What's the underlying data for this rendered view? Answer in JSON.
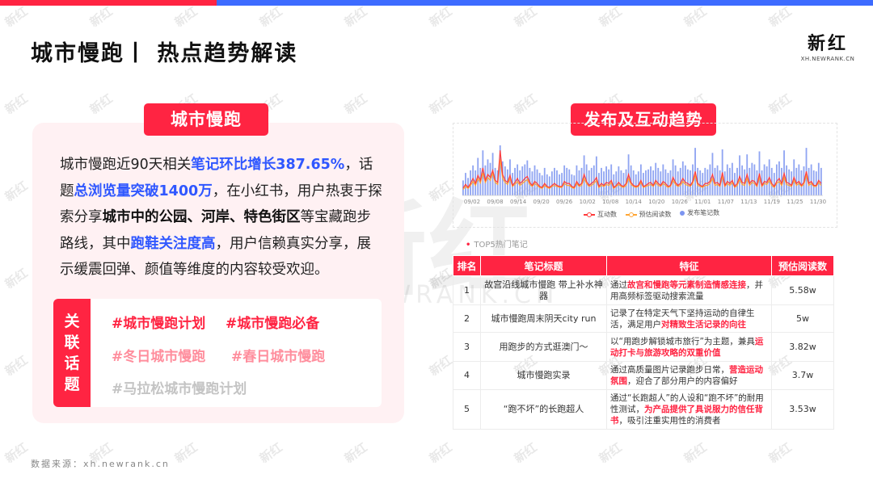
{
  "header": {
    "title": "城市慢跑丨 热点趋势解读",
    "logo_main": "新红",
    "logo_sub": "XH.NEWRANK.CN"
  },
  "watermark": {
    "big": "新红",
    "sub": "XH.NEWRANK.CN",
    "tile": "新红"
  },
  "left": {
    "tag": "城市慢跑",
    "desc": [
      {
        "t": "城市慢跑近90天相关",
        "s": ""
      },
      {
        "t": "笔记环比增长387.65%",
        "s": "blue"
      },
      {
        "t": "，话题",
        "s": ""
      },
      {
        "t": "总浏览量突破1400万",
        "s": "blue"
      },
      {
        "t": "，在小红书，用户热衷于探索分享",
        "s": ""
      },
      {
        "t": "城市中的公园、河岸、特色街区",
        "s": "bold"
      },
      {
        "t": "等宝藏跑步路线，其中",
        "s": ""
      },
      {
        "t": "跑鞋关注度高",
        "s": "blue"
      },
      {
        "t": "，用户信赖真实分享，展示缓震回弹、颜值等维度的内容较受欢迎。",
        "s": ""
      }
    ],
    "topics_label": [
      "关",
      "联",
      "话",
      "题"
    ],
    "topics": [
      "#城市慢跑计划",
      "#城市慢跑必备",
      "#冬日城市慢跑",
      "#春日城市慢跑",
      "#马拉松城市慢跑计划"
    ]
  },
  "source": "数据来源：xh.newrank.cn",
  "right": {
    "tag": "发布及互动趋势",
    "top5_label": "TOP5热门笔记",
    "table": {
      "headers": [
        "排名",
        "笔记标题",
        "特征",
        "预估阅读数"
      ],
      "rows": [
        {
          "rank": "1",
          "title": "故宫沿线城市慢跑 带上补水神器",
          "feat": [
            {
              "t": "通过",
              "h": false
            },
            {
              "t": "故宫和慢跑等元素制造情感连接",
              "h": true
            },
            {
              "t": "，并用高频标签驱动搜索流量",
              "h": false
            }
          ],
          "reads": "5.58w"
        },
        {
          "rank": "2",
          "title": "城市慢跑周末阴天city run",
          "feat": [
            {
              "t": "记录了在特定天气下坚持运动的自律生活，满足用户",
              "h": false
            },
            {
              "t": "对精致生活记录的向往",
              "h": true
            }
          ],
          "reads": "5w"
        },
        {
          "rank": "3",
          "title": "用跑步的方式逛澳门～",
          "feat": [
            {
              "t": "以“用跑步解锁城市旅行”为主题，兼具",
              "h": false
            },
            {
              "t": "运动打卡与旅游攻略的双重价值",
              "h": true
            }
          ],
          "reads": "3.82w"
        },
        {
          "rank": "4",
          "title": "城市慢跑实录",
          "feat": [
            {
              "t": "通过高质量图片记录跑步日常，",
              "h": false
            },
            {
              "t": "营造运动氛围",
              "h": true
            },
            {
              "t": "，迎合了部分用户的内容偏好",
              "h": false
            }
          ],
          "reads": "3.7w"
        },
        {
          "rank": "5",
          "title": "“跑不坏”的长跑超人",
          "feat": [
            {
              "t": "通过“长跑超人”的人设和“跑不坏”的耐用性测试，",
              "h": false
            },
            {
              "t": "为产品提供了具说服力的信任背书",
              "h": true
            },
            {
              "t": "，吸引注重实用性的消费者",
              "h": false
            }
          ],
          "reads": "3.53w"
        }
      ]
    }
  },
  "chart_data": {
    "type": "bar",
    "title": "",
    "x_ticks": [
      "09/02",
      "09/08",
      "09/14",
      "09/20",
      "09/26",
      "10/02",
      "10/08",
      "10/14",
      "10/20",
      "10/26",
      "11/01",
      "11/07",
      "11/13",
      "11/19",
      "11/25",
      "11/30"
    ],
    "legend": [
      "互动数",
      "预估阅读数",
      "发布笔记数"
    ],
    "legend_position": "bottom",
    "grid": false,
    "colors": {
      "interactions": "#ff3b3b",
      "reads": "#ffa534",
      "posts": "#7c95f0"
    },
    "series": [
      {
        "name": "发布笔记数",
        "values": [
          0.3,
          0.45,
          0.35,
          0.5,
          0.6,
          0.5,
          0.75,
          0.55,
          0.9,
          0.6,
          0.72,
          0.65,
          0.85,
          0.55,
          0.5,
          1.0,
          0.68,
          0.58,
          0.52,
          0.72,
          0.45,
          0.55,
          0.62,
          0.5,
          0.58,
          0.62,
          0.7,
          0.55,
          0.48,
          0.6,
          0.52,
          0.45,
          0.4,
          0.55,
          0.42,
          0.38,
          0.48,
          0.55,
          0.5,
          0.42,
          0.45,
          0.6,
          0.55,
          0.52,
          0.42,
          0.4,
          0.6,
          0.5,
          0.55,
          0.8,
          0.62,
          0.5,
          0.55,
          0.6,
          0.78,
          0.45,
          0.55,
          0.48,
          0.58,
          0.52,
          0.62,
          0.42,
          0.48,
          0.58,
          0.5,
          0.45,
          0.52,
          0.82,
          0.6,
          0.5,
          0.42,
          0.48,
          0.62,
          0.45,
          0.5,
          0.52,
          0.58,
          0.5,
          0.65,
          0.55,
          0.48,
          0.62,
          0.52,
          0.45,
          0.5,
          0.72,
          0.6,
          0.48,
          0.55,
          0.68,
          0.6,
          0.52,
          0.5,
          0.62,
          0.95,
          0.55,
          0.5,
          0.45,
          0.55,
          0.52,
          0.62,
          0.85,
          0.55,
          0.6,
          0.5,
          0.92,
          0.48,
          0.62,
          0.55,
          0.65,
          0.45,
          0.55,
          0.8,
          0.6,
          0.52,
          0.82,
          0.55,
          0.65,
          0.62,
          0.5,
          0.88,
          0.5,
          0.62,
          0.58,
          0.72,
          0.55,
          0.45,
          0.62,
          0.68,
          0.55,
          0.9,
          0.6,
          0.52,
          0.48,
          0.72,
          0.55,
          0.62,
          0.5,
          0.58,
          0.95,
          0.55,
          0.62,
          0.5,
          0.48,
          0.65,
          0.55
        ]
      },
      {
        "name": "预估阅读数",
        "values": [
          0.12,
          0.18,
          0.14,
          0.2,
          0.28,
          0.2,
          0.34,
          0.25,
          0.45,
          0.26,
          0.36,
          0.3,
          0.44,
          0.26,
          0.22,
          0.72,
          0.34,
          0.26,
          0.22,
          0.34,
          0.18,
          0.22,
          0.28,
          0.2,
          0.24,
          0.28,
          0.32,
          0.22,
          0.18,
          0.24,
          0.2,
          0.16,
          0.14,
          0.2,
          0.16,
          0.14,
          0.18,
          0.2,
          0.18,
          0.16,
          0.16,
          0.24,
          0.2,
          0.2,
          0.16,
          0.14,
          0.24,
          0.18,
          0.2,
          0.34,
          0.24,
          0.18,
          0.2,
          0.24,
          0.3,
          0.16,
          0.2,
          0.18,
          0.22,
          0.2,
          0.26,
          0.14,
          0.18,
          0.22,
          0.18,
          0.16,
          0.2,
          0.34,
          0.22,
          0.18,
          0.16,
          0.18,
          0.26,
          0.16,
          0.18,
          0.2,
          0.22,
          0.18,
          0.26,
          0.2,
          0.18,
          0.24,
          0.2,
          0.16,
          0.18,
          0.3,
          0.22,
          0.18,
          0.2,
          0.28,
          0.22,
          0.2,
          0.18,
          0.24,
          0.4,
          0.2,
          0.18,
          0.16,
          0.2,
          0.2,
          0.24,
          0.34,
          0.2,
          0.22,
          0.18,
          0.38,
          0.18,
          0.24,
          0.2,
          0.26,
          0.16,
          0.2,
          0.32,
          0.22,
          0.2,
          0.34,
          0.2,
          0.26,
          0.24,
          0.18,
          0.36,
          0.18,
          0.24,
          0.22,
          0.3,
          0.2,
          0.16,
          0.24,
          0.28,
          0.2,
          0.36,
          0.22,
          0.2,
          0.18,
          0.3,
          0.2,
          0.24,
          0.18,
          0.22,
          0.4,
          0.2,
          0.24,
          0.18,
          0.18,
          0.26,
          0.2
        ]
      },
      {
        "name": "互动数",
        "values": [
          0.15,
          0.22,
          0.16,
          0.24,
          0.34,
          0.24,
          0.4,
          0.3,
          0.55,
          0.3,
          0.42,
          0.36,
          0.5,
          0.3,
          0.26,
          0.9,
          0.42,
          0.3,
          0.26,
          0.4,
          0.2,
          0.26,
          0.34,
          0.24,
          0.28,
          0.34,
          0.38,
          0.26,
          0.2,
          0.28,
          0.24,
          0.18,
          0.16,
          0.24,
          0.18,
          0.16,
          0.2,
          0.24,
          0.2,
          0.18,
          0.18,
          0.28,
          0.24,
          0.24,
          0.18,
          0.16,
          0.28,
          0.2,
          0.24,
          0.42,
          0.28,
          0.2,
          0.24,
          0.28,
          0.36,
          0.18,
          0.24,
          0.2,
          0.26,
          0.24,
          0.3,
          0.16,
          0.2,
          0.26,
          0.2,
          0.18,
          0.24,
          0.42,
          0.26,
          0.2,
          0.18,
          0.2,
          0.3,
          0.18,
          0.2,
          0.24,
          0.26,
          0.2,
          0.3,
          0.24,
          0.2,
          0.28,
          0.24,
          0.18,
          0.2,
          0.36,
          0.26,
          0.2,
          0.24,
          0.34,
          0.26,
          0.24,
          0.2,
          0.28,
          0.48,
          0.24,
          0.2,
          0.18,
          0.24,
          0.24,
          0.28,
          0.42,
          0.24,
          0.26,
          0.2,
          0.46,
          0.2,
          0.28,
          0.24,
          0.3,
          0.18,
          0.24,
          0.38,
          0.26,
          0.24,
          0.42,
          0.24,
          0.3,
          0.28,
          0.2,
          0.44,
          0.2,
          0.28,
          0.26,
          0.36,
          0.24,
          0.18,
          0.28,
          0.34,
          0.24,
          0.44,
          0.26,
          0.24,
          0.2,
          0.36,
          0.24,
          0.28,
          0.2,
          0.26,
          0.48,
          0.24,
          0.28,
          0.2,
          0.2,
          0.3,
          0.24
        ]
      }
    ]
  }
}
